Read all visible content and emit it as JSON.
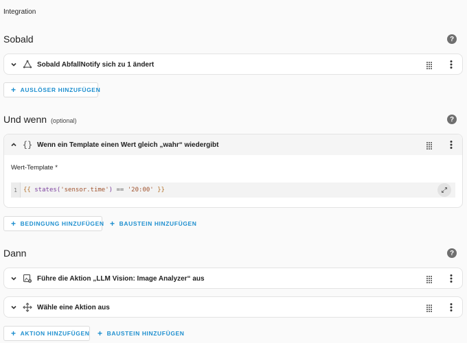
{
  "breadcrumb": "Integration",
  "sections": {
    "triggers": {
      "title": "Sobald",
      "help": "?",
      "card_label": "Sobald AbfallNotify sich zu 1 ändert",
      "add_button": "AUSLÖSER HINZUFÜGEN"
    },
    "conditions": {
      "title": "Und wenn",
      "optional": "(optional)",
      "help": "?",
      "card_label": "Wenn ein Template einen Wert gleich „wahr“ wiedergibt",
      "field_label": "Wert-Template *",
      "code_line_number": "1",
      "code": {
        "open": "{{",
        "fn": "states(",
        "arg": "'sensor.time'",
        "close_paren": ")",
        "op": "==",
        "value": "'20:00'",
        "close": "}}"
      },
      "add_button": "BEDINGUNG HINZUFÜGEN",
      "building_block_button": "BAUSTEIN HINZUFÜGEN"
    },
    "actions": {
      "title": "Dann",
      "help": "?",
      "card1_label": "Führe die Aktion „LLM Vision: Image Analyzer“ aus",
      "card2_label": "Wähle eine Aktion aus",
      "add_button": "AKTION HINZUFÜGEN",
      "building_block_button": "BAUSTEIN HINZUFÜGEN"
    }
  },
  "icons": {
    "chevron": "chevron-icon",
    "trigger": "state-trigger-icon",
    "template": "template-braces-icon",
    "action_llm": "image-analyzer-icon",
    "action_select": "arrows-move-icon",
    "drag": "drag-handle-icon",
    "menu": "kebab-menu-icon",
    "expand": "expand-icon",
    "plus": "+"
  },
  "colors": {
    "accent": "#1e8fcf",
    "background": "#fafafa",
    "card_header_active": "#f5f5f5"
  }
}
